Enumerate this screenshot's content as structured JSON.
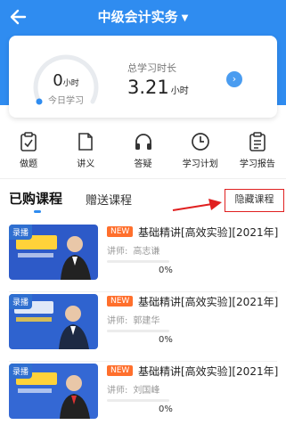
{
  "header": {
    "title": "中级会计实务",
    "back_icon": "back-arrow-icon",
    "caret_icon": "caret-down-icon",
    "color": "#2f8cf0"
  },
  "stats": {
    "today_value": "0",
    "today_unit": "小时",
    "today_label": "今日学习",
    "total_label": "总学习时长",
    "total_value": "3.21",
    "total_unit": "小时"
  },
  "menu": [
    {
      "label": "做题",
      "icon": "clipboard-icon"
    },
    {
      "label": "讲义",
      "icon": "document-icon"
    },
    {
      "label": "答疑",
      "icon": "headphones-icon"
    },
    {
      "label": "学习计划",
      "icon": "clock-icon"
    },
    {
      "label": "学习报告",
      "icon": "report-icon"
    }
  ],
  "tabs": {
    "purchased": "已购课程",
    "gifted": "赠送课程",
    "hide": "隐藏课程"
  },
  "courses": [
    {
      "badge": "录播",
      "new": "NEW",
      "title": "基础精讲[高效实验][2021年]",
      "teacher_label": "讲师:",
      "teacher": "高志谦",
      "progress": "0%",
      "progress_value": 0
    },
    {
      "badge": "录播",
      "new": "NEW",
      "title": "基础精讲[高效实验][2021年]",
      "teacher_label": "讲师:",
      "teacher": "郭建华",
      "progress": "0%",
      "progress_value": 0
    },
    {
      "badge": "录播",
      "new": "NEW",
      "title": "基础精讲[高效实验][2021年]",
      "teacher_label": "讲师:",
      "teacher": "刘国峰",
      "progress": "0%",
      "progress_value": 0
    }
  ]
}
